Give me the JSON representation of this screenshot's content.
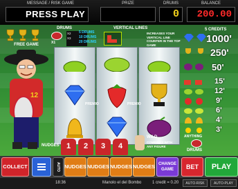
{
  "header": {
    "message_label": "MESSAGE / RISK GAME",
    "message_text": "PRESS PLAY",
    "prize_label": "PRIZE",
    "drums_label": "DRUMS",
    "drums_value": "0",
    "balance_label": "BALANCE",
    "balance_value": "200.00"
  },
  "left_panel": {
    "free_game_label": "FREE GAME",
    "drums_title": "DRUMS",
    "drums_rows": [
      {
        "mult": "X1",
        "text": "5 DRUMS"
      },
      {
        "mult": "X2",
        "text": "10 DRUMS"
      },
      {
        "mult": "X3",
        "text": "20 DRUMS"
      }
    ]
  },
  "vertical_lines": {
    "title": "VERTICAL LINES",
    "text": "INCREASES YOUR VERTICAL LINE COUNTER IN THE TOP GAME"
  },
  "reels": {
    "premio_label": "PREMIO",
    "wild_title": "WILD",
    "wild_text": "COMBINES WITH ANY FIGURE"
  },
  "nudges": {
    "label": "NUDGES",
    "numbers": [
      "1",
      "2",
      "3",
      "4"
    ]
  },
  "paytable": {
    "credits_label": "5 CREDITS",
    "values": [
      "1000'",
      "250'",
      "50'",
      "15'",
      "12'",
      "9'",
      "6'",
      "4'",
      "3'"
    ],
    "anything_label": "ANYTHING",
    "drums_label": "DRUMS"
  },
  "controls": {
    "collect": "COLLECT",
    "auto": "AUTO",
    "nudges": "NUDGES",
    "change_game": "CHANGE GAME",
    "bet": "BET",
    "play": "PLAY"
  },
  "status": {
    "time": "18:36",
    "title": "Manolo el del Bombo",
    "credit": "1 credit = 0.20",
    "auto_risk": "AUTO-RISK",
    "auto_play": "AUTO-PLAY"
  },
  "colors": {
    "balance": "#ff2a2a",
    "drums": "#f4d21c",
    "collect": "#d0242a",
    "play": "#22a83a",
    "bet": "#d7262e",
    "nudges": "#e07d16"
  }
}
